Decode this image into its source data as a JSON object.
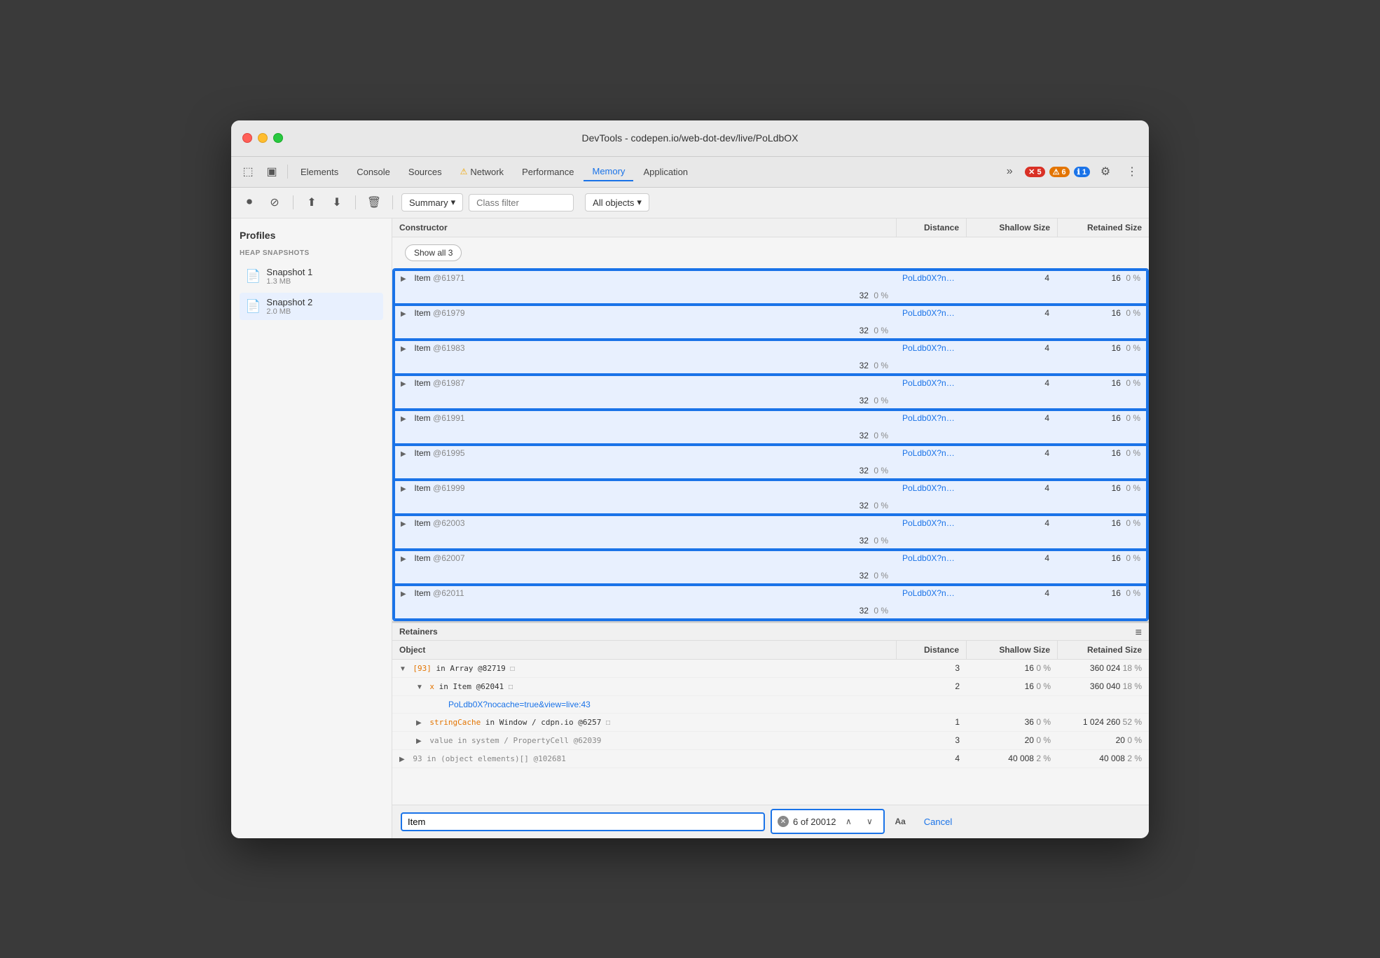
{
  "window": {
    "title": "DevTools - codepen.io/web-dot-dev/live/PoLdbOX"
  },
  "tabs": [
    {
      "label": "Elements",
      "active": false
    },
    {
      "label": "Console",
      "active": false
    },
    {
      "label": "Sources",
      "active": false
    },
    {
      "label": "Network",
      "active": false,
      "warn": true
    },
    {
      "label": "Performance",
      "active": false
    },
    {
      "label": "Memory",
      "active": true
    },
    {
      "label": "Application",
      "active": false
    }
  ],
  "badges": {
    "error_count": "5",
    "warn_count": "6",
    "info_count": "1"
  },
  "toolbar": {
    "summary_label": "Summary",
    "class_filter_placeholder": "Class filter",
    "all_objects_label": "All objects"
  },
  "sidebar": {
    "profiles_title": "Profiles",
    "heap_snapshots_title": "HEAP SNAPSHOTS",
    "snapshots": [
      {
        "name": "Snapshot 1",
        "size": "1.3 MB",
        "active": false
      },
      {
        "name": "Snapshot 2",
        "size": "2.0 MB",
        "active": true
      }
    ]
  },
  "constructor_table": {
    "headers": [
      "Constructor",
      "Distance",
      "Shallow Size",
      "Retained Size"
    ],
    "show_all_label": "Show all 3",
    "rows": [
      {
        "name": "Item",
        "id": "@61971",
        "link": "PoLdb0X?nocache=true&view=live:43",
        "distance": "4",
        "shallow": "16",
        "shallow_pct": "0 %",
        "retained": "32",
        "retained_pct": "0 %",
        "selected": true
      },
      {
        "name": "Item",
        "id": "@61979",
        "link": "PoLdb0X?nocache=true&view=live:43",
        "distance": "4",
        "shallow": "16",
        "shallow_pct": "0 %",
        "retained": "32",
        "retained_pct": "0 %",
        "selected": true
      },
      {
        "name": "Item",
        "id": "@61983",
        "link": "PoLdb0X?nocache=true&view=live:43",
        "distance": "4",
        "shallow": "16",
        "shallow_pct": "0 %",
        "retained": "32",
        "retained_pct": "0 %",
        "selected": true
      },
      {
        "name": "Item",
        "id": "@61987",
        "link": "PoLdb0X?nocache=true&view=live:43",
        "distance": "4",
        "shallow": "16",
        "shallow_pct": "0 %",
        "retained": "32",
        "retained_pct": "0 %",
        "selected": true
      },
      {
        "name": "Item",
        "id": "@61991",
        "link": "PoLdb0X?nocache=true&view=live:43",
        "distance": "4",
        "shallow": "16",
        "shallow_pct": "0 %",
        "retained": "32",
        "retained_pct": "0 %",
        "selected": true
      },
      {
        "name": "Item",
        "id": "@61995",
        "link": "PoLdb0X?nocache=true&view=live:43",
        "distance": "4",
        "shallow": "16",
        "shallow_pct": "0 %",
        "retained": "32",
        "retained_pct": "0 %",
        "selected": true
      },
      {
        "name": "Item",
        "id": "@61999",
        "link": "PoLdb0X?nocache=true&view=live:43",
        "distance": "4",
        "shallow": "16",
        "shallow_pct": "0 %",
        "retained": "32",
        "retained_pct": "0 %",
        "selected": true
      },
      {
        "name": "Item",
        "id": "@62003",
        "link": "PoLdb0X?nocache=true&view=live:43",
        "distance": "4",
        "shallow": "16",
        "shallow_pct": "0 %",
        "retained": "32",
        "retained_pct": "0 %",
        "selected": true
      },
      {
        "name": "Item",
        "id": "@62007",
        "link": "PoLdb0X?nocache=true&view=live:43",
        "distance": "4",
        "shallow": "16",
        "shallow_pct": "0 %",
        "retained": "32",
        "retained_pct": "0 %",
        "selected": true
      },
      {
        "name": "Item",
        "id": "@62011",
        "link": "PoLdb0X?nocache=true&view=live:43",
        "distance": "4",
        "shallow": "16",
        "shallow_pct": "0 %",
        "retained": "32",
        "retained_pct": "0 %",
        "selected": true
      }
    ]
  },
  "retainers_table": {
    "section_label": "Retainers",
    "headers": [
      "Object",
      "Distance",
      "Shallow Size",
      "Retained Size"
    ],
    "rows": [
      {
        "label": "[93] in Array @82719",
        "flag": true,
        "indent": 0,
        "distance": "3",
        "shallow": "16",
        "shallow_pct": "0 %",
        "retained": "360 024",
        "retained_pct": "18 %"
      },
      {
        "label": "x in Item @62041",
        "flag": true,
        "indent": 1,
        "distance": "2",
        "shallow": "16",
        "shallow_pct": "0 %",
        "retained": "360 040",
        "retained_pct": "18 %"
      },
      {
        "label": "PoLdb0X?nocache=true&view=live:43",
        "link": true,
        "indent": 2,
        "distance": "",
        "shallow": "",
        "shallow_pct": "",
        "retained": "",
        "retained_pct": ""
      },
      {
        "label": "stringCache in Window / cdpn.io @6257",
        "flag": true,
        "indent": 1,
        "distance": "1",
        "shallow": "36",
        "shallow_pct": "0 %",
        "retained": "1 024 260",
        "retained_pct": "52 %"
      },
      {
        "label": "value in system / PropertyCell @62039",
        "indent": 1,
        "distance": "3",
        "shallow": "20",
        "shallow_pct": "0 %",
        "retained": "20",
        "retained_pct": "0 %"
      },
      {
        "label": "93 in (object elements)[] @102681",
        "indent": 0,
        "distance": "4",
        "shallow": "40 008",
        "shallow_pct": "2 %",
        "retained": "40 008",
        "retained_pct": "2 %"
      }
    ]
  },
  "search": {
    "query": "Item",
    "count_label": "6 of 20012",
    "aa_label": "Aa",
    "cancel_label": "Cancel"
  }
}
